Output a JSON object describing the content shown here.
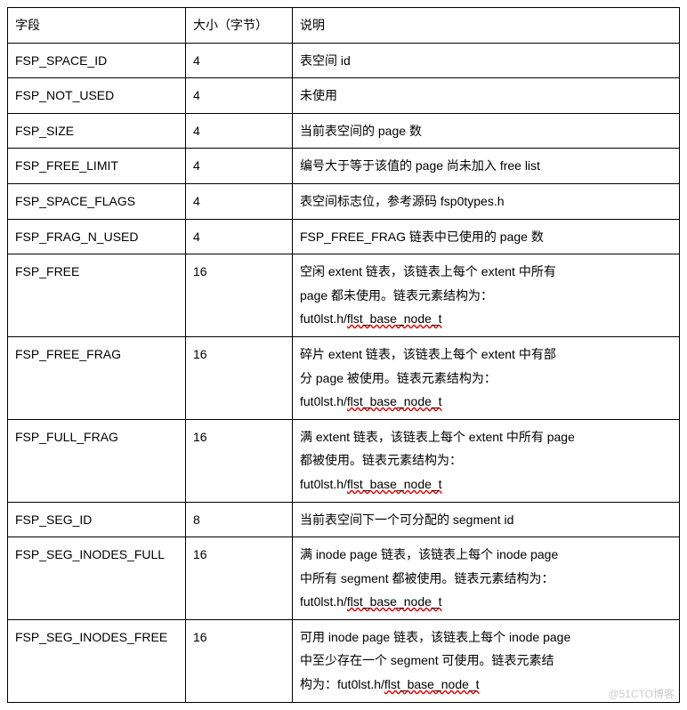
{
  "headers": {
    "field": "字段",
    "size": "大小（字节）",
    "desc": "说明"
  },
  "rows": [
    {
      "field": "FSP_SPACE_ID",
      "size": "4",
      "desc": [
        {
          "plain": "表空间 id"
        }
      ]
    },
    {
      "field": "FSP_NOT_USED",
      "size": "4",
      "desc": [
        {
          "plain": "未使用"
        }
      ]
    },
    {
      "field": "FSP_SIZE",
      "size": "4",
      "desc": [
        {
          "plain": "当前表空间的 page 数"
        }
      ]
    },
    {
      "field": "FSP_FREE_LIMIT",
      "size": "4",
      "desc": [
        {
          "plain": "编号大于等于该值的 page 尚未加入 free list"
        }
      ]
    },
    {
      "field": "FSP_SPACE_FLAGS",
      "size": "4",
      "desc": [
        {
          "plain": "表空间标志位，参考源码 fsp0types.h"
        }
      ]
    },
    {
      "field": "FSP_FRAG_N_USED",
      "size": "4",
      "desc": [
        {
          "plain": "FSP_FREE_FRAG 链表中已使用的 page 数"
        }
      ]
    },
    {
      "field": "FSP_FREE",
      "size": "16",
      "desc": [
        {
          "plain": "空闲 extent 链表，该链表上每个 extent 中所有",
          "justify": true
        },
        {
          "plain": "page 都未使用。链表元素结构为：",
          "justify": true
        },
        {
          "prefix": "fut0lst.h/",
          "spell": "flst_base_node_t"
        }
      ]
    },
    {
      "field": "FSP_FREE_FRAG",
      "size": "16",
      "desc": [
        {
          "plain": "碎片 extent 链表，该链表上每个 extent 中有部",
          "justify": true
        },
        {
          "plain": "分 page 被使用。链表元素结构为：",
          "justify": true
        },
        {
          "prefix": "fut0lst.h/",
          "spell": "flst_base_node_t"
        }
      ]
    },
    {
      "field": "FSP_FULL_FRAG",
      "size": "16",
      "desc": [
        {
          "plain": "满 extent 链表，该链表上每个 extent 中所有 page",
          "justify": true
        },
        {
          "plain": "都被使用。链表元素结构为：",
          "justify": true
        },
        {
          "prefix": "fut0lst.h/",
          "spell": "flst_base_node_t"
        }
      ]
    },
    {
      "field": "FSP_SEG_ID",
      "size": "8",
      "desc": [
        {
          "plain": "当前表空间下一个可分配的 segment id"
        }
      ]
    },
    {
      "field": "FSP_SEG_INODES_FULL",
      "size": "16",
      "desc": [
        {
          "plain": "满 inode page 链表，该链表上每个 inode page",
          "justify": true
        },
        {
          "plain": "中所有 segment 都被使用。链表元素结构为：",
          "justify": true
        },
        {
          "prefix": "fut0lst.h/",
          "spell": "flst_base_node_t"
        }
      ]
    },
    {
      "field": "FSP_SEG_INODES_FREE",
      "size": "16",
      "desc": [
        {
          "plain": "可用 inode page 链表，该链表上每个 inode page",
          "justify": true
        },
        {
          "plain": "中至少存在一个 segment 可使用。链表元素结",
          "justify": true
        },
        {
          "prefix": "构为：fut0lst.h/",
          "spell": "flst_base_node_t"
        }
      ]
    }
  ],
  "watermark": "@51CTO博客"
}
